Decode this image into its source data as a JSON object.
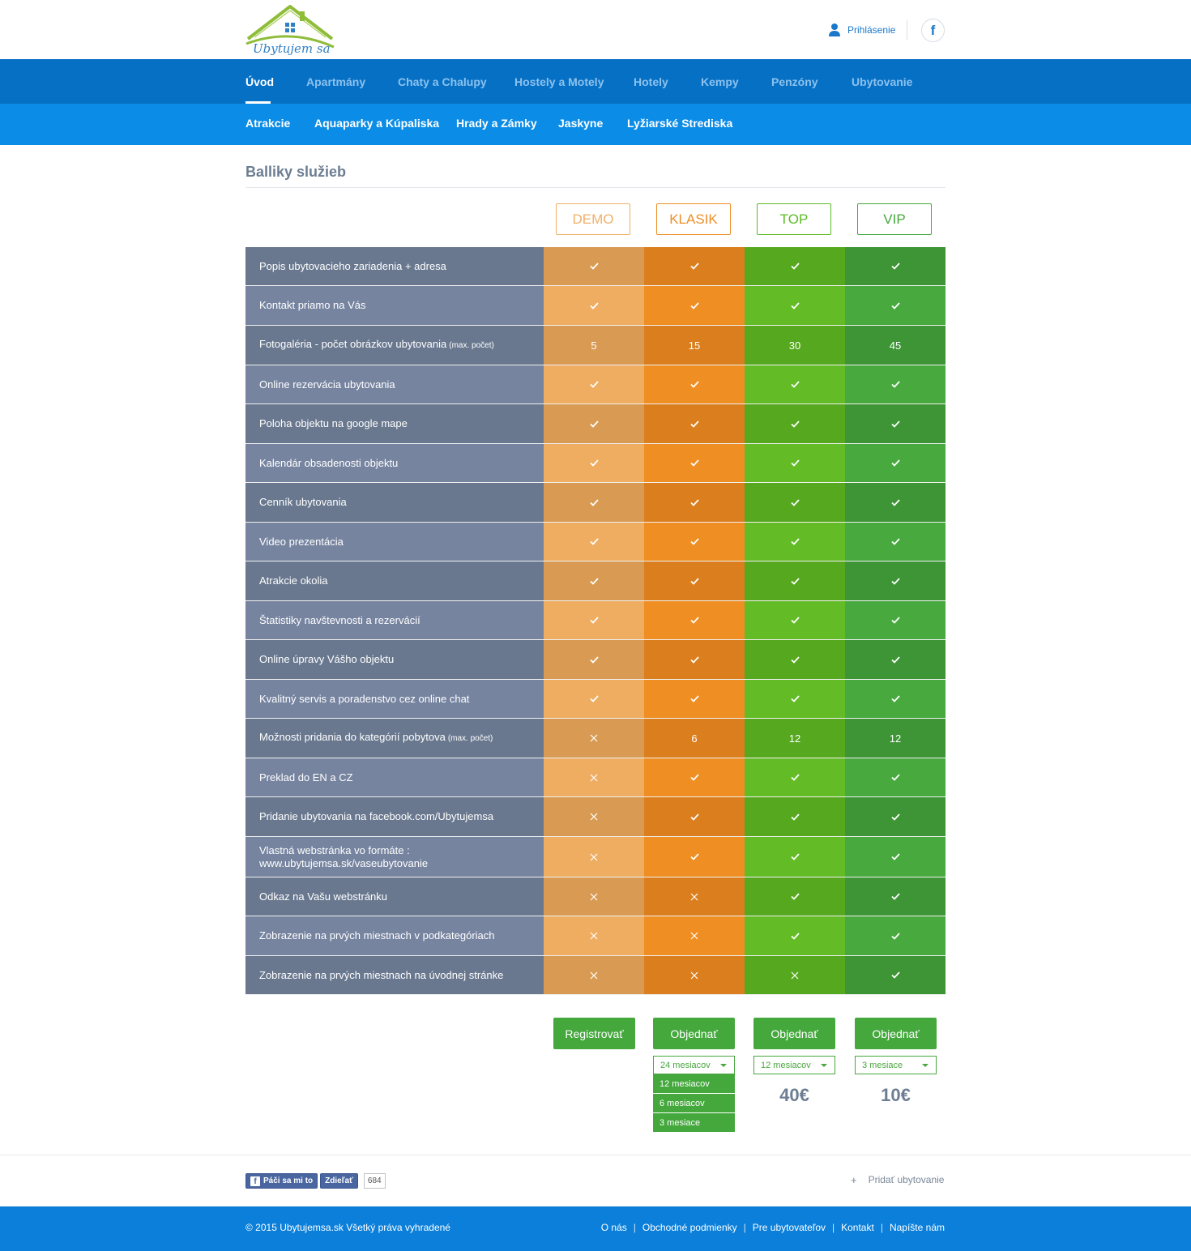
{
  "header": {
    "logo_text": "Ubytujem sa",
    "login_label": "Prihlásenie",
    "facebook_glyph": "f"
  },
  "nav_primary": [
    {
      "label": "Úvod",
      "active": true
    },
    {
      "label": "Apartmány"
    },
    {
      "label": "Chaty a Chalupy"
    },
    {
      "label": "Hostely a Motely"
    },
    {
      "label": "Hotely"
    },
    {
      "label": "Kempy"
    },
    {
      "label": "Penzóny"
    },
    {
      "label": "Ubytovanie"
    }
  ],
  "nav_secondary": [
    {
      "label": "Atrakcie"
    },
    {
      "label": "Aquaparky a Kúpaliska"
    },
    {
      "label": "Hrady a Zámky"
    },
    {
      "label": "Jaskyne"
    },
    {
      "label": "Lyžiarské Strediska"
    }
  ],
  "section_title": "Balliky služieb",
  "plans": [
    {
      "name": "DEMO",
      "color": "#f0b069"
    },
    {
      "name": "KLASIK",
      "color": "#ef8e26"
    },
    {
      "name": "TOP",
      "color": "#5cbb26"
    },
    {
      "name": "VIP",
      "color": "#44a83d"
    }
  ],
  "colors": {
    "label_dark": "#69788f",
    "label_light": "#7684a0",
    "demo_dark": "#d99b53",
    "demo_light": "#efad62",
    "klasik_dark": "#db7e1e",
    "klasik_light": "#ef8e22",
    "top_dark": "#56a81f",
    "top_light": "#63bc26",
    "vip_dark": "#3d9535",
    "vip_light": "#48aa3e"
  },
  "features": [
    {
      "label": "Popis ubytovacieho zariadenia + adresa",
      "values": [
        "check",
        "check",
        "check",
        "check"
      ]
    },
    {
      "label": "Kontakt priamo na Vás",
      "values": [
        "check",
        "check",
        "check",
        "check"
      ]
    },
    {
      "label": "Fotogaléria - počet obrázkov ubytovania",
      "note": "(max. počet)",
      "values": [
        "5",
        "15",
        "30",
        "45"
      ]
    },
    {
      "label": "Online rezervácia ubytovania",
      "values": [
        "check",
        "check",
        "check",
        "check"
      ]
    },
    {
      "label": "Poloha objektu na google mape",
      "values": [
        "check",
        "check",
        "check",
        "check"
      ]
    },
    {
      "label": "Kalendár obsadenosti objektu",
      "values": [
        "check",
        "check",
        "check",
        "check"
      ]
    },
    {
      "label": "Cenník ubytovania",
      "values": [
        "check",
        "check",
        "check",
        "check"
      ]
    },
    {
      "label": "Video prezentácia",
      "values": [
        "check",
        "check",
        "check",
        "check"
      ]
    },
    {
      "label": "Atrakcie okolia",
      "values": [
        "check",
        "check",
        "check",
        "check"
      ]
    },
    {
      "label": "Štatistiky navštevnosti a rezervácií",
      "values": [
        "check",
        "check",
        "check",
        "check"
      ]
    },
    {
      "label": "Online úpravy Vášho objektu",
      "values": [
        "check",
        "check",
        "check",
        "check"
      ]
    },
    {
      "label": "Kvalitný servis a poradenstvo cez online chat",
      "values": [
        "check",
        "check",
        "check",
        "check"
      ]
    },
    {
      "label": "Možnosti pridania do kategórií pobytova",
      "note": "(max. počet)",
      "values": [
        "x",
        "6",
        "12",
        "12"
      ]
    },
    {
      "label": "Preklad do EN a CZ",
      "values": [
        "x",
        "check",
        "check",
        "check"
      ]
    },
    {
      "label": "Pridanie ubytovania na facebook.com/Ubytujemsa",
      "values": [
        "x",
        "check",
        "check",
        "check"
      ]
    },
    {
      "label": "Vlastná webstránka vo formáte :",
      "label2": "www.ubytujemsa.sk/vaseubytovanie",
      "values": [
        "x",
        "check",
        "check",
        "check"
      ]
    },
    {
      "label": "Odkaz na Vašu webstránku",
      "values": [
        "x",
        "x",
        "check",
        "check"
      ]
    },
    {
      "label": "Zobrazenie na prvých miestnach v podkategóriach",
      "values": [
        "x",
        "x",
        "check",
        "check"
      ]
    },
    {
      "label": "Zobrazenie na prvých miestnach na úvodnej stránke",
      "values": [
        "x",
        "x",
        "x",
        "check"
      ]
    }
  ],
  "actions": {
    "demo_button": "Registrovať",
    "klasik_button": "Objednať",
    "top_button": "Objednať",
    "vip_button": "Objednať",
    "klasik_select": "24 mesiacov",
    "top_select": "12 mesiacov",
    "vip_select": "3 mesiace",
    "klasik_options": [
      "12 mesiacov",
      "6 mesiacov",
      "3 mesiace"
    ],
    "top_price": "40€",
    "vip_price": "10€"
  },
  "footer": {
    "like_label": "Páči sa mi to",
    "share_label": "Zdieľať",
    "like_count": "684",
    "add_plus": "+",
    "add_label": "Pridať ubytovanie",
    "copyright": "© 2015 Ubytujemsa.sk Všetký práva vyhradené",
    "links": [
      "O nás",
      "Obchodné podmienky",
      "Pre ubytovateľov",
      "Kontakt",
      "Napíšte nám"
    ],
    "separator": "|"
  }
}
